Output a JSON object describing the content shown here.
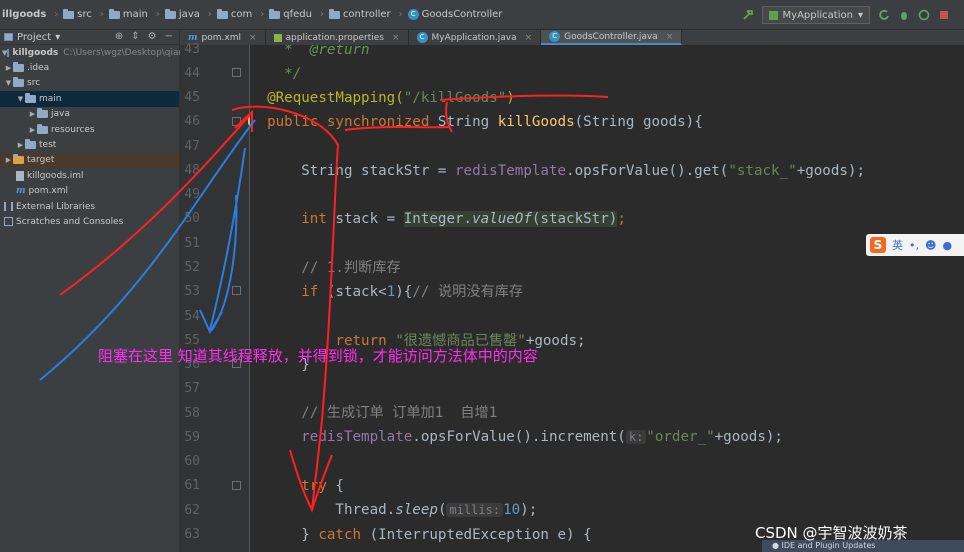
{
  "breadcrumbs": [
    "illgoods",
    "src",
    "main",
    "java",
    "com",
    "qfedu",
    "controller",
    "GoodsController"
  ],
  "run_config": "MyApplication",
  "project_panel": {
    "title": "Project",
    "root_name": "killgoods",
    "root_path": "C:\\Users\\wgz\\Desktop\\qian",
    "items": [
      ".idea",
      "src",
      "main",
      "java",
      "resources",
      "test",
      "target",
      "killgoods.iml",
      "pom.xml",
      "External Libraries",
      "Scratches and Consoles"
    ]
  },
  "tabs": [
    "pom.xml",
    "application.properties",
    "MyApplication.java",
    "GoodsController.java"
  ],
  "line_numbers": [
    "43",
    "44",
    "45",
    "46",
    "47",
    "48",
    "49",
    "50",
    "51",
    "52",
    "53",
    "54",
    "55",
    "56",
    "57",
    "58",
    "59",
    "60",
    "61",
    "62",
    "63"
  ],
  "code": {
    "l43_doc": "@return",
    "l44": "*/",
    "l45_ann": "@RequestMapping(",
    "l45_str": "\"/killGoods\"",
    "l45_end": ")",
    "l46_kw": "public synchronized",
    "l46_type": " String ",
    "l46_method": "killGoods",
    "l46_params": "(String goods){",
    "l48_a": "String stackStr = ",
    "l48_field": "redisTemplate",
    "l48_b": ".opsForValue().get(",
    "l48_str": "\"stack_\"",
    "l48_c": "+goods);",
    "l50_kw": "int",
    "l50_a": " stack = ",
    "l50_cls": "Integer.",
    "l50_m": "valueOf",
    "l50_b": "(stackStr)",
    "l50_c": ";",
    "l52": "// 1.判断库存",
    "l53_kw": "if",
    "l53_a": " (stack<",
    "l53_num": "1",
    "l53_b": "){",
    "l53_cmt": "// 说明没有库存",
    "l55_kw": "return",
    "l55_str": "\"很遗憾商品已售罄\"",
    "l55_b": "+goods;",
    "l56": "}",
    "l58": "// 生成订单 订单加1  自增1",
    "l59_field": "redisTemplate",
    "l59_a": ".opsForValue().increment(",
    "l59_hint": "k:",
    "l59_str": "\"order_\"",
    "l59_b": "+goods);",
    "l61_kw": "try",
    "l61_a": " {",
    "l62_a": "Thread.",
    "l62_m": "sleep",
    "l62_b": "(",
    "l62_hint": "millis:",
    "l62_num": "10",
    "l62_c": ");",
    "l63_a": "} ",
    "l63_kw": "catch",
    "l63_b": " (InterruptedException e) {"
  },
  "annotation_text": "阻塞在这里 知道其线程释放，并得到锁，才能访问方法体中的内容",
  "ime": {
    "logo": "S",
    "lang": "英"
  },
  "watermark": "CSDN @宇智波波奶茶",
  "popup": "IDE and Plugin Updates",
  "colors": {
    "annotation": "#ff2ef0",
    "red_stroke": "#ff2020",
    "blue_stroke": "#2a7de1"
  }
}
